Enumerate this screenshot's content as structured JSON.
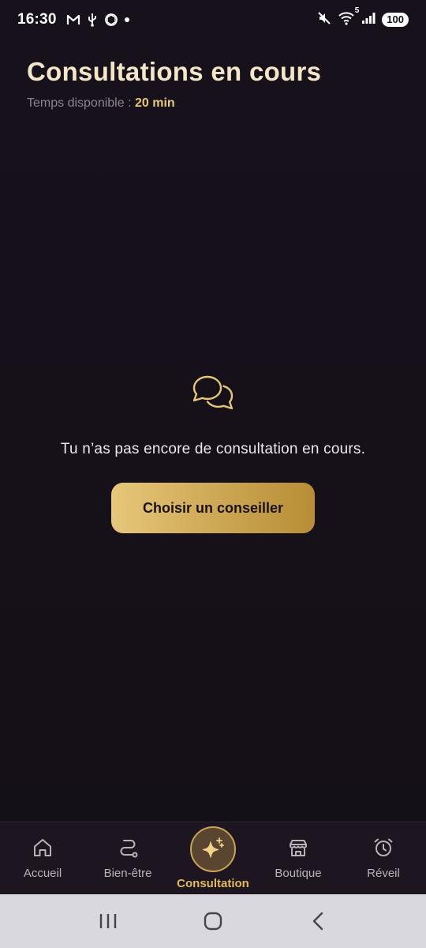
{
  "status_bar": {
    "time": "16:30",
    "battery": "100",
    "network_badge": "5"
  },
  "header": {
    "title": "Consultations en cours",
    "time_label": "Temps disponible :",
    "time_value": "20 min"
  },
  "empty_state": {
    "message": "Tu n’as pas encore de consultation en cours.",
    "button_label": "Choisir un conseiller"
  },
  "bottom_nav": {
    "active_color": "#e3b95c",
    "items": [
      {
        "label": "Accueil",
        "icon": "home-icon"
      },
      {
        "label": "Bien-être",
        "icon": "path-icon"
      },
      {
        "label": "Consultation",
        "icon": "sparkle-icon",
        "active": true
      },
      {
        "label": "Boutique",
        "icon": "store-icon"
      },
      {
        "label": "Réveil",
        "icon": "alarm-clock-icon"
      }
    ]
  },
  "colors": {
    "accent_gold": "#e7c875",
    "background": "#151019"
  }
}
